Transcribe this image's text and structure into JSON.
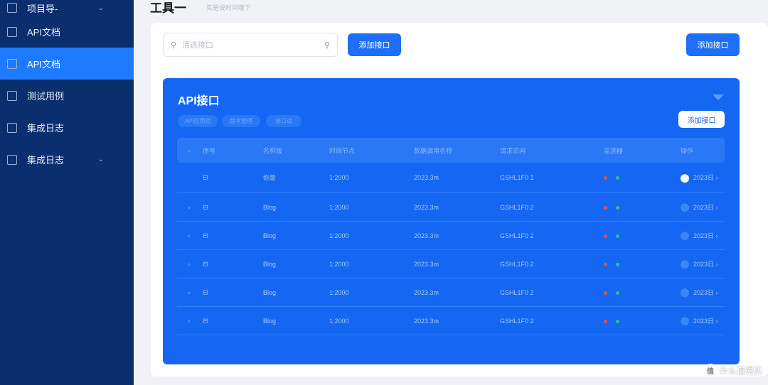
{
  "sidebar": {
    "items": [
      {
        "label": "项目导-",
        "active": false,
        "chevron": true
      },
      {
        "label": "API文档",
        "active": false
      },
      {
        "label": "API文档",
        "active": true
      },
      {
        "label": "测试用例",
        "active": false
      },
      {
        "label": "集成日志",
        "active": false
      },
      {
        "label": "集成日志",
        "active": false,
        "chevron": true
      }
    ]
  },
  "header": {
    "title": "工具一",
    "subtitle": "实是说时间哦下"
  },
  "toolbar": {
    "search_placeholder": "清选接口",
    "add_button": "添加接口",
    "add_button_right": "添加接口"
  },
  "panel": {
    "title": "API接口",
    "chips": [
      "API应用组",
      "版本管理",
      "接口说"
    ],
    "add_button": "添加接口",
    "columns": [
      "序号",
      "名称版",
      "时间节点",
      "数据调用名称",
      "请求访问",
      "监测器",
      "操作"
    ],
    "rows": [
      {
        "name": "你是",
        "time": "1:2000",
        "data": "2023.3m",
        "req": "GSHL1F0  1",
        "action": "2023日"
      },
      {
        "name": "Blog",
        "time": "1:2000",
        "data": "2023.3m",
        "req": "GSHL1F0  2",
        "action": "2023日"
      },
      {
        "name": "Blog",
        "time": "1:2000",
        "data": "2023.3m",
        "req": "GSHL1F0  2",
        "action": "2023日"
      },
      {
        "name": "Blog",
        "time": "1:2000",
        "data": "2023.3m",
        "req": "GSHL1F0  2",
        "action": "2023日"
      },
      {
        "name": "Blog",
        "time": "1:2000",
        "data": "2023.3m",
        "req": "GSHL1F0  2",
        "action": "2023日"
      },
      {
        "name": "Blog",
        "time": "1:2000",
        "data": "2023.3m",
        "req": "GSHL1F0  2",
        "action": "2023日"
      }
    ]
  },
  "colors": {
    "sidebar": "#0b2f6e",
    "accent": "#1e7bff",
    "panel": "#1567f3",
    "status_red": "#e0514b",
    "status_green": "#22c58b"
  },
  "watermark": "值 什么值得买"
}
